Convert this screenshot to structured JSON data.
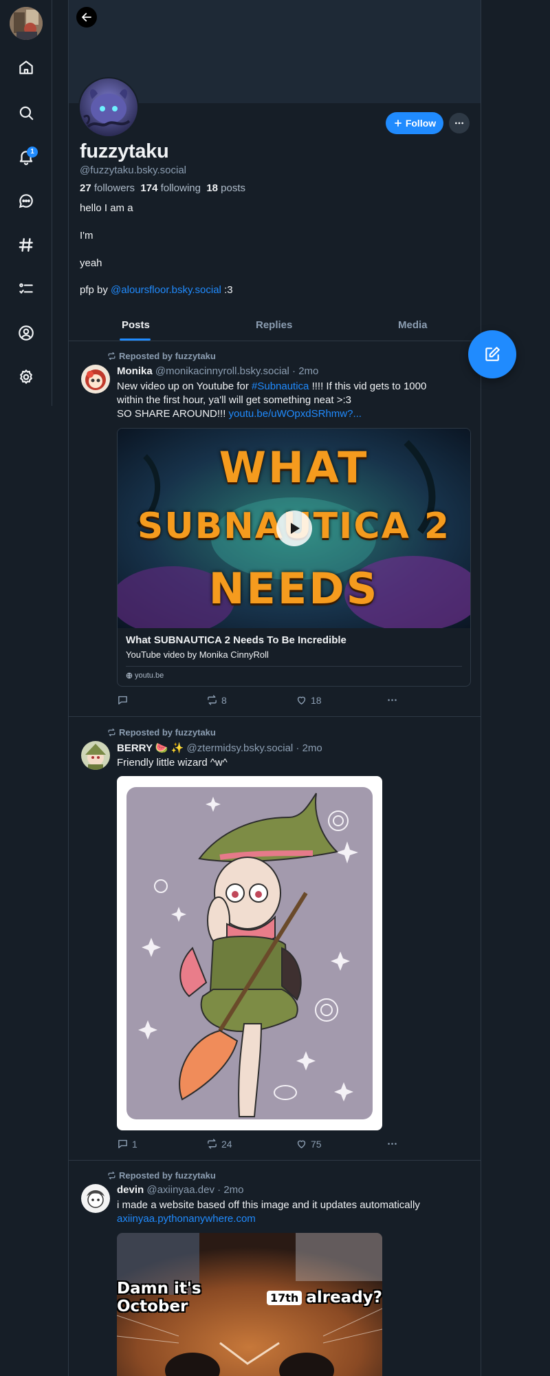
{
  "nav": {
    "items": [
      {
        "name": "home",
        "label": "Home"
      },
      {
        "name": "search",
        "label": "Search"
      },
      {
        "name": "notifications",
        "label": "Notifications"
      },
      {
        "name": "chat",
        "label": "Chat"
      },
      {
        "name": "feeds",
        "label": "Feeds"
      },
      {
        "name": "lists",
        "label": "Lists"
      },
      {
        "name": "profile",
        "label": "Profile"
      },
      {
        "name": "settings",
        "label": "Settings"
      }
    ],
    "notification_count": "1"
  },
  "profile": {
    "display_name": "fuzzytaku",
    "handle": "@fuzzytaku.bsky.social",
    "followers_count": "27",
    "followers_label": "followers",
    "following_count": "174",
    "following_label": "following",
    "posts_count": "18",
    "posts_label": "posts",
    "follow_label": "Follow",
    "bio_lines": [
      "hello I am a",
      "I'm",
      "yeah"
    ],
    "bio_pfp_prefix": "pfp by",
    "bio_pfp_mention": "@aloursfloor.bsky.social",
    "bio_pfp_suffix": ":3"
  },
  "tabs": [
    "Posts",
    "Replies",
    "Media"
  ],
  "posts": [
    {
      "repost_label": "Reposted by fuzzytaku",
      "author_name": "Monika",
      "author_handle": "@monikacinnyroll.bsky.social",
      "time": "· 2mo",
      "text_line1_a": "New video up on Youtube for",
      "text_line1_tag": "#Subnautica",
      "text_line1_b": "!!!! If this vid gets to 1000",
      "text_line2": "within the first hour, ya'll will get something neat >:3",
      "text_line3_a": "SO SHARE AROUND!!!",
      "text_line3_link": "youtu.be/uWOpxdSRhmw?...",
      "embed": {
        "thumb_text_top": "WHAT",
        "thumb_text_mid": "SUBNAUTICA 2",
        "thumb_text_bottom": "NEEDS",
        "title": "What SUBNAUTICA 2 Needs To Be Incredible",
        "description": "YouTube video by Monika CinnyRoll",
        "domain": "youtu.be"
      },
      "replies": "",
      "reposts": "8",
      "likes": "18"
    },
    {
      "repost_label": "Reposted by fuzzytaku",
      "author_name": "BERRY 🍉 ✨",
      "author_handle": "@ztermidsy.bsky.social",
      "time": "· 2mo",
      "text": "Friendly little wizard ^w^",
      "replies": "1",
      "reposts": "24",
      "likes": "75"
    },
    {
      "repost_label": "Reposted by fuzzytaku",
      "author_name": "devin",
      "author_handle": "@axiinyaa.dev",
      "time": "· 2mo",
      "text": "i made a website based off this image and it updates automatically",
      "link": "axiinyaa.pythonanywhere.com",
      "image_caption_a": "Damn it's October",
      "image_caption_badge": "17th",
      "image_caption_b": "already?"
    }
  ],
  "colors": {
    "background": "#161e27",
    "accent": "#208bfe",
    "muted": "#8c9eb2",
    "border": "#2e3945"
  }
}
